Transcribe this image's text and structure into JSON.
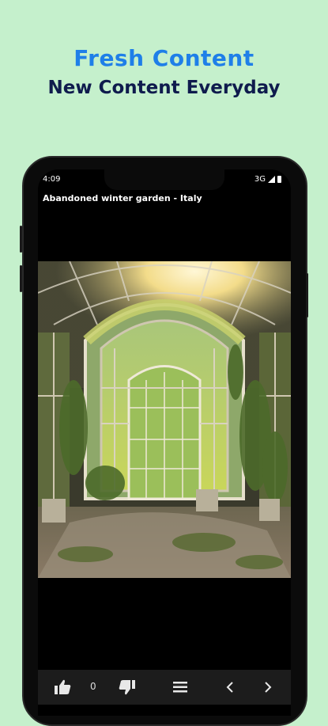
{
  "promo": {
    "title": "Fresh Content",
    "subtitle": "New Content Everyday"
  },
  "status_bar": {
    "time": "4:09",
    "network": "3G"
  },
  "post": {
    "caption": "Abandoned winter garden - Italy"
  },
  "toolbar": {
    "like_count": "0",
    "icons": [
      "thumbs-up-icon",
      "thumbs-down-icon",
      "menu-icon",
      "chevron-left-icon",
      "chevron-right-icon"
    ]
  },
  "colors": {
    "background": "#c5f0cc",
    "title_blue": "#1f7fe8",
    "subtitle_navy": "#0f1b4d",
    "toolbar": "#1c1c1c"
  }
}
